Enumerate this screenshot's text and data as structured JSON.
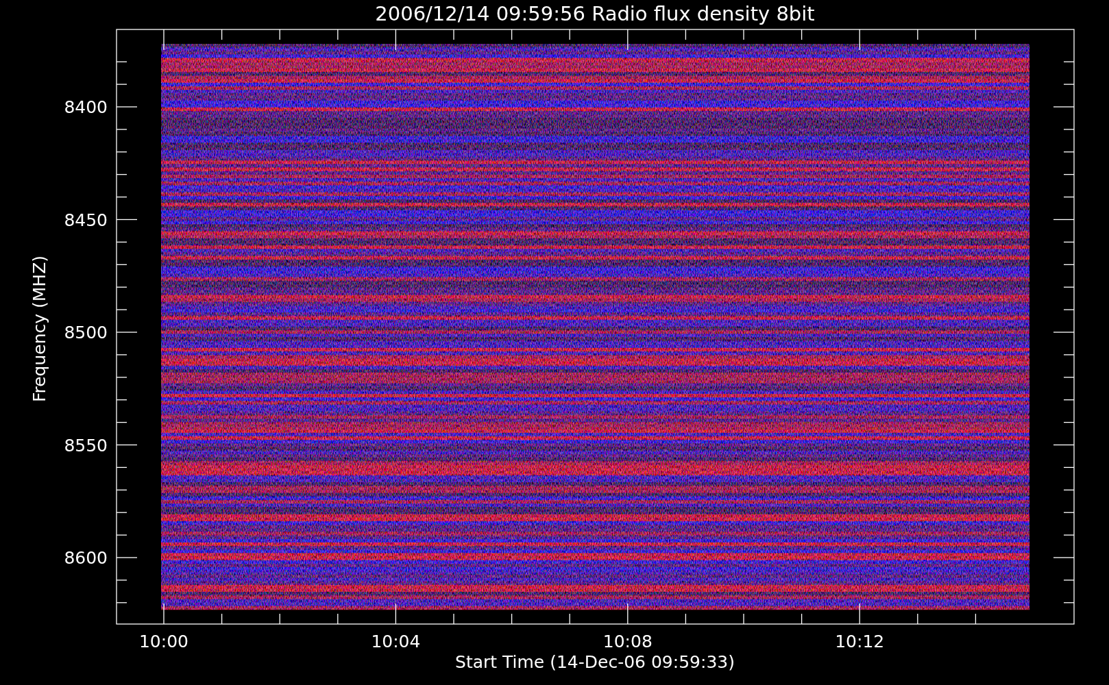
{
  "plot": {
    "title": "2006/12/14 09:59:56 Radio flux density 8bit",
    "ylabel": "Frequency (MHZ)",
    "xlabel": "Start Time (14-Dec-06 09:59:33)",
    "y_tick_labels": [
      "8400",
      "8450",
      "8500",
      "8550",
      "8600"
    ],
    "x_tick_labels": [
      "10:00",
      "10:04",
      "10:08",
      "10:12"
    ]
  }
}
